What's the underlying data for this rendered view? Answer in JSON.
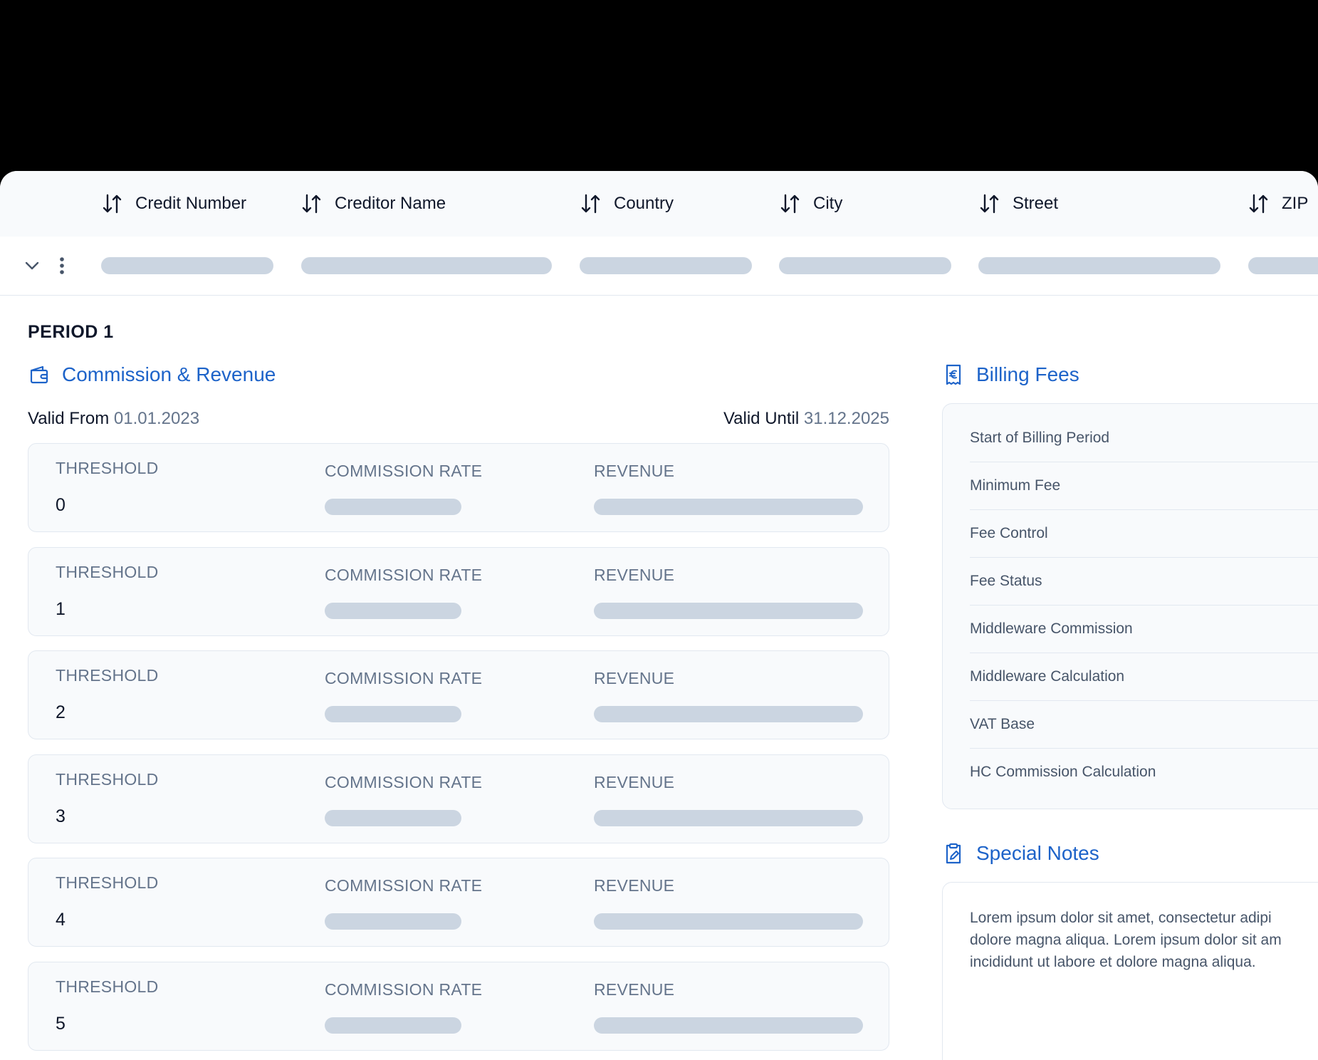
{
  "table": {
    "columns": [
      {
        "label": "Credit Number"
      },
      {
        "label": "Creditor Name"
      },
      {
        "label": "Country"
      },
      {
        "label": "City"
      },
      {
        "label": "Street"
      },
      {
        "label": "ZIP"
      }
    ]
  },
  "period": {
    "title": "PERIOD 1",
    "commission_section_title": "Commission & Revenue",
    "valid_from_label": "Valid From",
    "valid_from_value": "01.01.2023",
    "valid_until_label": "Valid Until",
    "valid_until_value": "31.12.2025",
    "threshold_label": "THRESHOLD",
    "commission_rate_label": "COMMISSION RATE",
    "revenue_label": "REVENUE",
    "thresholds": [
      "0",
      "1",
      "2",
      "3",
      "4",
      "5"
    ]
  },
  "billing": {
    "title": "Billing Fees",
    "items": [
      "Start of Billing Period",
      "Minimum Fee",
      "Fee Control",
      "Fee Status",
      "Middleware Commission",
      "Middleware Calculation",
      "VAT Base",
      "HC Commission Calculation"
    ]
  },
  "notes": {
    "title": "Special Notes",
    "lines": [
      "Lorem ipsum dolor sit amet, consectetur adipi",
      "dolore magna aliqua. Lorem ipsum dolor sit am",
      "incididunt ut labore et dolore magna aliqua."
    ]
  },
  "colors": {
    "accent": "#1d63c9",
    "skeleton": "#cbd5e1",
    "border": "#e2e8f0",
    "muted_text": "#64748b"
  },
  "icons": {
    "sort": "sort-arrows-icon",
    "expand": "chevron-down-icon",
    "more": "more-vertical-icon",
    "commission": "wallet-icon",
    "billing": "euro-receipt-icon",
    "notes": "clipboard-edit-icon"
  }
}
